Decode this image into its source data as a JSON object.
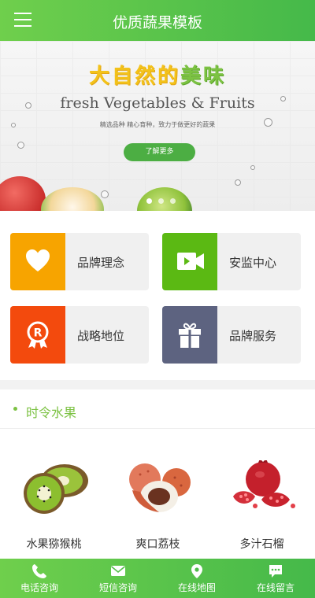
{
  "header": {
    "title": "优质蔬果模板",
    "menu_icon": "menu-icon"
  },
  "banner": {
    "title_part1": "大自然的",
    "title_part2": "美味",
    "subtitle": "fresh Vegetables & Fruits",
    "description": "精选品种 精心育种，致力于做更好的蔬果",
    "button_label": "了解更多",
    "slide_count": 3,
    "active_slide": 1
  },
  "features": [
    {
      "label": "品牌理念",
      "icon": "heart-icon",
      "color": "#f7a400"
    },
    {
      "label": "安监中心",
      "icon": "video-camera-icon",
      "color": "#5bb913"
    },
    {
      "label": "战略地位",
      "icon": "registered-badge-icon",
      "color": "#f34a0d"
    },
    {
      "label": "品牌服务",
      "icon": "gift-icon",
      "color": "#5d6380"
    }
  ],
  "section": {
    "title": "时令水果",
    "products": [
      {
        "name": "水果猕猴桃",
        "icon": "kiwi-image"
      },
      {
        "name": "爽口荔枝",
        "icon": "lychee-image"
      },
      {
        "name": "多汁石榴",
        "icon": "pomegranate-image"
      }
    ]
  },
  "bottom_nav": [
    {
      "label": "电话咨询",
      "icon": "phone-icon"
    },
    {
      "label": "短信咨询",
      "icon": "envelope-icon"
    },
    {
      "label": "在线地图",
      "icon": "map-pin-icon"
    },
    {
      "label": "在线留言",
      "icon": "chat-icon"
    }
  ],
  "colors": {
    "brand_green": "#6fcf4c",
    "title_green": "#7cc243",
    "banner_yellow": "#f3c21a"
  }
}
